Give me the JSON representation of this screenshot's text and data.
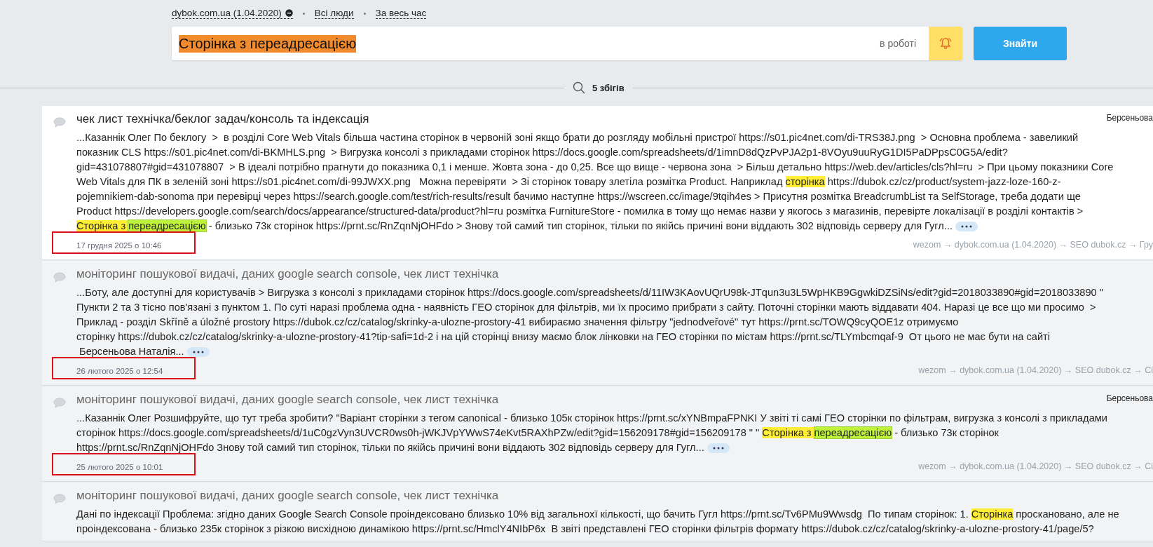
{
  "filters": [
    {
      "label": "dybok.com.ua (1.04.2020)",
      "kind": "project"
    },
    {
      "label": "Всі люди",
      "kind": "plain"
    },
    {
      "label": "За весь час",
      "kind": "plain"
    }
  ],
  "search": {
    "value": "Сторінка з переадресацією",
    "value_selected": true,
    "status": "в роботі",
    "button": "Знайти"
  },
  "summary": "5 збігів",
  "results": [
    {
      "title": "чек лист технічка/беклог задач/консоль та індексація",
      "author": "Берсеньова",
      "selected": true,
      "annotated": true,
      "lines": [
        [
          {
            "text": "...Казаннік Олег По беклогу  >  в розділі Core Web Vitals більша частина сторінок в червоній зоні якщо брати до розгляду мобільні пристрої https://s01.pic4net.com/di-TRS38J.png  > Основна проблема - завеликий",
            "kind": "text"
          }
        ],
        [
          {
            "text": "показник CLS https://s01.pic4net.com/di-BKMHLS.png  > Вигрузка консолі з прикладами сторінок https://docs.google.com/spreadsheets/d/1imnD8dQzPvPJA2p1-8VOyu9uuRyG1DI5PaDPpsC0G5A/edit?",
            "kind": "text"
          }
        ],
        [
          {
            "text": "gid=431078807#gid=431078807  > В ідеалі потрібно прагнути до показника 0,1 і менше. Жовта зона - до 0,25. Все що вище - червона зона  > Більш детально https://web.dev/articles/cls?hl=ru  > При цьому показники Core",
            "kind": "text"
          }
        ],
        [
          {
            "text": "Web Vitals для ПК в зеленій зоні https://s01.pic4net.com/di-99JWXX.png   Можна перевіряти  > Зі сторінок товару злетіла розмітка Product. Наприклад ",
            "kind": "text"
          },
          {
            "text": "сторінка",
            "kind": "hit"
          },
          {
            "text": " https://dubok.cz/cz/product/system-jazz-loze-160-z-",
            "kind": "text"
          }
        ],
        [
          {
            "text": "pojemnikiem-dab-sonoma при перевірці через https://search.google.com/test/rich-results/result бачимо наступне https://wscreen.cc/image/9tqih4es > Присутня розмітка BreadcrumbList та SelfStorage, треба додати ще",
            "kind": "text"
          }
        ],
        [
          {
            "text": "Product https://developers.google.com/search/docs/appearance/structured-data/product?hl=ru розмітка FurnitureStore - помилка в тому що немає назви у якогось з магазинів, перевірте локалізації в розділі контактів >",
            "kind": "text"
          }
        ],
        [
          {
            "text": "Сторінка з ",
            "kind": "hit"
          },
          {
            "text": "переадресацією",
            "kind": "exact"
          },
          {
            "text": " - близько 73к сторінок https://prnt.sc/RnZqnNjOHFdo > Знову той самий тип сторінок, тільки по якійсь причині вони віддають 302 відповідь серверу для Гугл...",
            "kind": "text"
          }
        ]
      ],
      "more": true,
      "date": "17 грудня 2025 о 10:46",
      "path": "wezom → dybok.com.ua (1.04.2020) → SEO dubok.cz → Гру"
    },
    {
      "title": "моніторинг пошукової видачі, даних google search console, чек лист технічка",
      "selected": false,
      "annotated": true,
      "lines": [
        [
          {
            "text": "...Боту, але доступні для користувачів > Вигрузка з консолі з прикладами сторінок https://docs.google.com/spreadsheets/d/11IW3KAovUQrU98k-JTqun3u3L5WpHKB9GgwkiDZSiNs/edit?gid=2018033890#gid=2018033890 \"",
            "kind": "text"
          }
        ],
        [
          {
            "text": "Пункти 2 та 3 тісно пов'язані з пунктом 1. По суті наразі проблема одна - наявність ГЕО сторінок для фільтрів, ми їх просимо прибрати з сайту. Поточні сторінки мають віддавати 404. Наразі це все що ми просимо  >",
            "kind": "text"
          }
        ],
        [
          {
            "text": "Приклад - розділ Skříně a úložné prostory https://dubok.cz/cz/catalog/skrinky-a-ulozne-prostory-41 вибираємо значення фільтру \"jednodveřové\" тут https://prnt.sc/TOWQ9cyQOE1z отримуємо",
            "kind": "text"
          }
        ],
        [
          {
            "text": "сторінку https://dubok.cz/cz/catalog/skrinky-a-ulozne-prostory-41?tip-safi=1d-2 і на цій сторінці внизу маємо блок лінковки на ГЕО сторінки по містам https://prnt.sc/TLYmbcmqaf-9  От цього не має бути на сайті",
            "kind": "text"
          }
        ],
        [
          {
            "text": " Берсеньова Наталія...",
            "kind": "text"
          }
        ]
      ],
      "more": true,
      "date": "26 лютого 2025 о 12:54",
      "path": "wezom → dybok.com.ua (1.04.2020) → SEO dubok.cz → Сі"
    },
    {
      "title": "моніторинг пошукової видачі, даних google search console, чек лист технічка",
      "author": "Берсеньова",
      "selected": false,
      "annotated": true,
      "lines": [
        [
          {
            "text": "...Казаннік Олег Розшифруйте, що тут треба зробити? \"Варіант сторінки з тегом canonical - близько 105к сторінок https://prnt.sc/xYNBmpaFPNKI У звіті ті самі ГЕО сторінки по фільтрам, вигрузка з консолі з прикладами",
            "kind": "text"
          }
        ],
        [
          {
            "text": "сторінок https://docs.google.com/spreadsheets/d/1uC0gzVyn3UVCR0ws0h-jWKJVpYWwS74eKvt5RAXhPZw/edit?gid=156209178#gid=156209178 \" \" ",
            "kind": "text"
          },
          {
            "text": "Сторінка з ",
            "kind": "hit"
          },
          {
            "text": "переадресацією",
            "kind": "exact"
          },
          {
            "text": " - близько 73к сторінок",
            "kind": "text"
          }
        ],
        [
          {
            "text": "https://prnt.sc/RnZqnNjOHFdo Знову той самий тип сторінок, тільки по якійсь причині вони віддають 302 відповідь серверу для Гугл...",
            "kind": "text"
          }
        ]
      ],
      "more": true,
      "date": "25 лютого 2025 о 10:01",
      "path": "wezom → dybok.com.ua (1.04.2020) → SEO dubok.cz → Сі"
    },
    {
      "title": "моніторинг пошукової видачі, даних google search console, чек лист технічка",
      "selected": false,
      "annotated": false,
      "lines": [
        [
          {
            "text": "Дані по індексації Проблема: згідно даних Google Search Console проіндексовано близько 10% від загальноxї кількості, що бачить Гугл https://prnt.sc/Tv6PMu9Wwsdg  По типам сторінок: 1. ",
            "kind": "text"
          },
          {
            "text": "Сторінка",
            "kind": "hit"
          },
          {
            "text": " проскановано, але не",
            "kind": "text"
          }
        ],
        [
          {
            "text": "проіндексована - близько 235к сторінок з різкою висхідною динамікою https://prnt.sc/HmclY4NIbP6x  В звіті представлені ГЕО сторінки фільтрів формату https://dubok.cz/cz/catalog/skrinky-a-ulozne-prostory-41/page/5?",
            "kind": "text"
          }
        ]
      ],
      "more": false
    }
  ]
}
